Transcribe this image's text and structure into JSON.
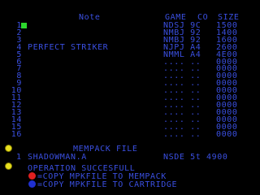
{
  "header": {
    "note": "Note",
    "game": "GAME",
    "co": "CO",
    "size": "SIZE"
  },
  "rows": [
    {
      "num": "1",
      "note": "",
      "gc": "NDSJ 9C",
      "size": "1500"
    },
    {
      "num": "2",
      "note": "",
      "gc": "NMBJ 92",
      "size": "1400"
    },
    {
      "num": "3",
      "note": "",
      "gc": "NMBJ 92",
      "size": "1600"
    },
    {
      "num": "4",
      "note": "PERFECT STRIKER",
      "gc": "NJPJ A4",
      "size": "2600"
    },
    {
      "num": "5",
      "note": "",
      "gc": "NMML A4",
      "size": "4E00"
    },
    {
      "num": "6",
      "note": "",
      "gc": ".... ..",
      "size": "0000"
    },
    {
      "num": "7",
      "note": "",
      "gc": ".... ..",
      "size": "0000"
    },
    {
      "num": "8",
      "note": "",
      "gc": ".... ..",
      "size": "0000"
    },
    {
      "num": "9",
      "note": "",
      "gc": ".... ..",
      "size": "0000"
    },
    {
      "num": "10",
      "note": "",
      "gc": ".... ..",
      "size": "0000"
    },
    {
      "num": "11",
      "note": "",
      "gc": ".... ..",
      "size": "0000"
    },
    {
      "num": "12",
      "note": "",
      "gc": ".... ..",
      "size": "0000"
    },
    {
      "num": "13",
      "note": "",
      "gc": ".... ..",
      "size": "0000"
    },
    {
      "num": "14",
      "note": "",
      "gc": ".... ..",
      "size": "0000"
    },
    {
      "num": "15",
      "note": "",
      "gc": ".... ..",
      "size": "0000"
    },
    {
      "num": "16",
      "note": "",
      "gc": ".... ..",
      "size": "0000"
    }
  ],
  "mempack": {
    "title": "MEMPACK FILE",
    "index": "1",
    "filename": "SHADOWMAN.A",
    "info": "NSDE 5t 4900"
  },
  "status": "OPERATION SUCCESFULL",
  "actions": [
    {
      "label": "=COPY MPKFILE TO MEMPACK",
      "color": "#e02020"
    },
    {
      "label": "=COPY MPKFILE TO CARTRIDGE",
      "color": "#2030d0"
    }
  ]
}
